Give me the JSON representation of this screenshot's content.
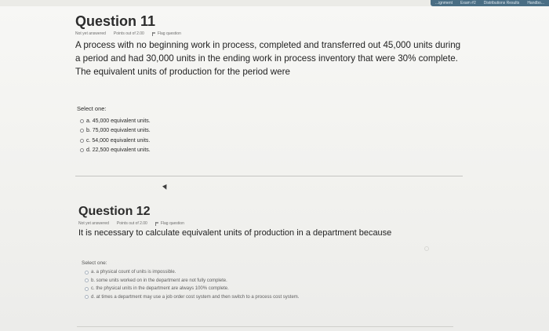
{
  "top_nav": {
    "items": [
      "...ignment",
      "Exam #2",
      "Distributions Results",
      "Handbo..."
    ]
  },
  "question11": {
    "title": "Question 11",
    "status": "Not yet answered",
    "points": "Points out of 2.00",
    "flag_label": "Flag question",
    "text": "A process with no beginning work in process, completed and transferred out 45,000 units during a period and had 30,000 units in the ending work in process inventory that were 30% complete. The equivalent units of production for the period were",
    "select_label": "Select one:",
    "options": [
      "a. 45,000 equivalent units.",
      "b. 75,000 equivalent units.",
      "c. 54,000 equivalent units.",
      "d. 22,500 equivalent units."
    ]
  },
  "question12": {
    "title": "Question 12",
    "status": "Not yet answered",
    "points": "Points out of 2.00",
    "flag_label": "Flag question",
    "text": "It is necessary to calculate equivalent units of production in a department because",
    "select_label": "Select one:",
    "options": [
      "a. a physical count of units is impossible.",
      "b. some units worked on in the department are not fully complete.",
      "c. the physical units in the department are always 100% complete.",
      "d. at times a department may use a job order cost system and then switch to a process cost system."
    ]
  },
  "colors": {
    "nav_bar": "#4a6e84",
    "radio_q12": "#aab4bf"
  },
  "icons": {
    "flag": "flag-icon",
    "cursor": "cursor-icon",
    "radio": "radio-icon"
  }
}
